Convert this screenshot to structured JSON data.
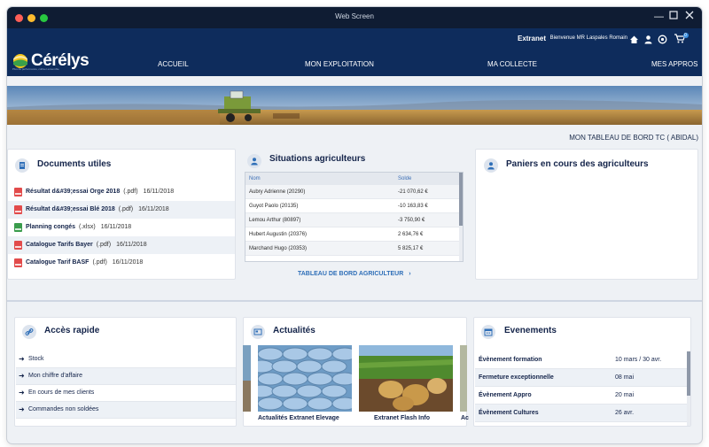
{
  "window": {
    "title": "Web Screen"
  },
  "header": {
    "extranet_label": "Extranet",
    "welcome": "Bienvenue MR Laspales Romain",
    "cart_count": "0",
    "logo_name": "Cérélys",
    "logo_tagline": "Plus de performance, cultiver ensemble"
  },
  "nav": {
    "items": [
      "ACCUEIL",
      "MON EXPLOITATION",
      "MA COLLECTE",
      "MES APPROS"
    ]
  },
  "dashboard_title": "MON TABLEAU DE BORD TC  ( ABIDAL)",
  "documents": {
    "title": "Documents utiles",
    "items": [
      {
        "name": "Résultat d&#39;essai Orge 2018",
        "ext": "(.pdf)",
        "date": "16/11/2018",
        "type": "pdf"
      },
      {
        "name": "Résultat d&#39;essai Blé 2018",
        "ext": "(.pdf)",
        "date": "16/11/2018",
        "type": "pdf"
      },
      {
        "name": "Planning congés",
        "ext": "(.xlsx)",
        "date": "16/11/2018",
        "type": "xlsx"
      },
      {
        "name": "Catalogue Tarifs Bayer",
        "ext": "(.pdf)",
        "date": "16/11/2018",
        "type": "pdf"
      },
      {
        "name": "Catalogue Tarif BASF",
        "ext": "(.pdf)",
        "date": "16/11/2018",
        "type": "pdf"
      }
    ]
  },
  "situations": {
    "title": "Situations agriculteurs",
    "columns": [
      "Nom",
      "Solde"
    ],
    "rows": [
      {
        "name": "Aubry Adrienne (20290)",
        "balance": "-21 070,62 €"
      },
      {
        "name": "Guyot Paolo (20135)",
        "balance": "-10 163,83 €"
      },
      {
        "name": "Lemou Arthur (80897)",
        "balance": "-3 750,90 €"
      },
      {
        "name": "Hubert Augustin (20376)",
        "balance": "2 634,76 €"
      },
      {
        "name": "Marchand Hugo (20353)",
        "balance": "5 825,17 €"
      }
    ],
    "link": "TABLEAU DE BORD AGRICULTEUR"
  },
  "paniers": {
    "title": "Paniers en cours des agriculteurs"
  },
  "acces_rapide": {
    "title": "Accès rapide",
    "items": [
      "Stock",
      "Mon chiffre d'affaire",
      "En cours de mes clients",
      "Commandes non soldées"
    ]
  },
  "actualites": {
    "title": "Actualités",
    "items": [
      {
        "caption": "Actualités Extranet Elevage"
      },
      {
        "caption": "Extranet Flash Info"
      },
      {
        "caption": "Ac"
      }
    ]
  },
  "evenements": {
    "title": "Evenements",
    "items": [
      {
        "name": "Évènement formation",
        "date": "10 mars / 30 avr."
      },
      {
        "name": "Fermeture exceptionnelle",
        "date": "08 mai"
      },
      {
        "name": "Évènement Appro",
        "date": "20 mai"
      },
      {
        "name": "Évènement Cultures",
        "date": "26 avr."
      }
    ]
  },
  "colors": {
    "header": "#0e2c5c",
    "link": "#2f6fb8",
    "text": "#14244a"
  }
}
